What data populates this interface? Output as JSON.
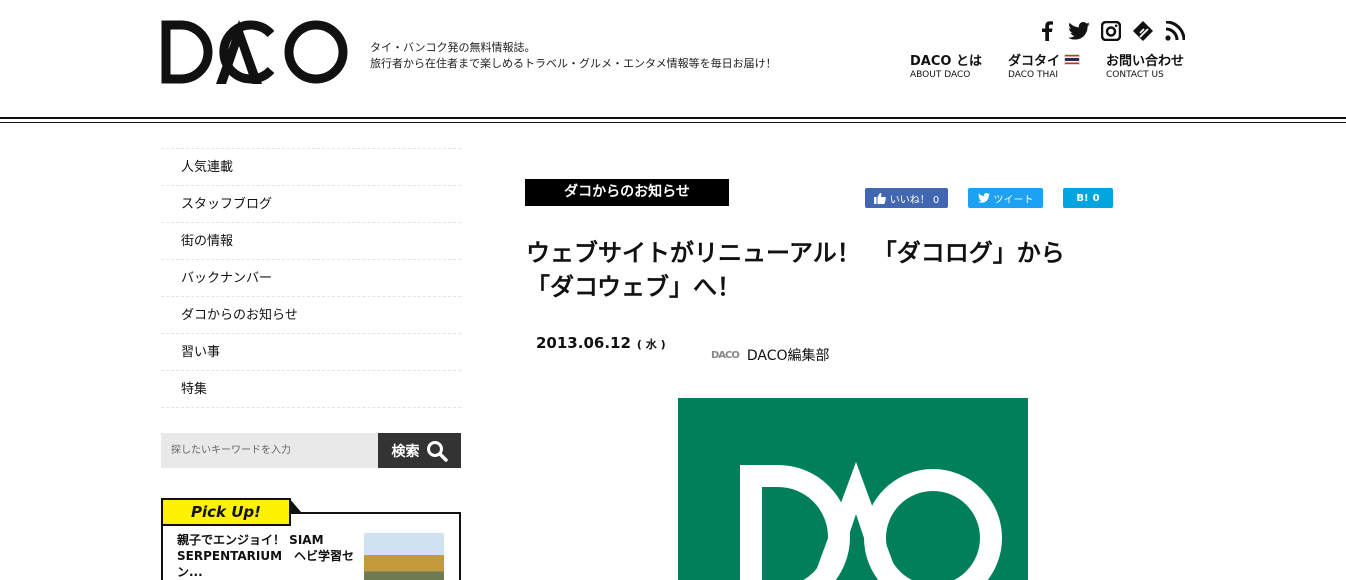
{
  "header": {
    "logo_text": "DACO",
    "tagline_line1": "タイ・バンコク発の無料情報誌。",
    "tagline_line2": "旅行者から在住者まで楽しめるトラベル・グルメ・エンタメ情報等を毎日お届け！",
    "social_icons": [
      "facebook-icon",
      "twitter-icon",
      "instagram-icon",
      "feedly-icon",
      "rss-icon"
    ],
    "nav": [
      {
        "jp": "DACO とは",
        "en": "ABOUT DACO"
      },
      {
        "jp": "ダコタイ",
        "en": "DACO THAI"
      },
      {
        "jp": "お問い合わせ",
        "en": "CONTACT US"
      }
    ]
  },
  "sidebar": {
    "menu": [
      "人気連載",
      "スタッフブログ",
      "街の情報",
      "バックナンバー",
      "ダコからのお知らせ",
      "習い事",
      "特集"
    ],
    "search": {
      "placeholder": "探したいキーワードを入力",
      "button": "検索"
    },
    "pickup": {
      "label": "Pick Up!",
      "item_title": "親子でエンジョイ！ SIAM SERPENTARIUM　ヘビ学習セン..."
    }
  },
  "article": {
    "category": "ダコからのお知らせ",
    "share": {
      "facebook": "いいね！ 0",
      "twitter": "ツイート",
      "hatena_label": "B!",
      "hatena_count": "0"
    },
    "title_line1": "ウェブサイトがリニューアル！　「ダコログ」から",
    "title_line2": "「ダコウェブ」へ！",
    "date": "2013.06.12",
    "weekday": "( 水 )",
    "author_logo": "DACO",
    "author": "DACO編集部"
  },
  "colors": {
    "brand_green": "#007f5a",
    "pickup_yellow": "#fff200",
    "facebook": "#4267b2",
    "twitter": "#1da1f2",
    "hatena": "#00a4de"
  }
}
